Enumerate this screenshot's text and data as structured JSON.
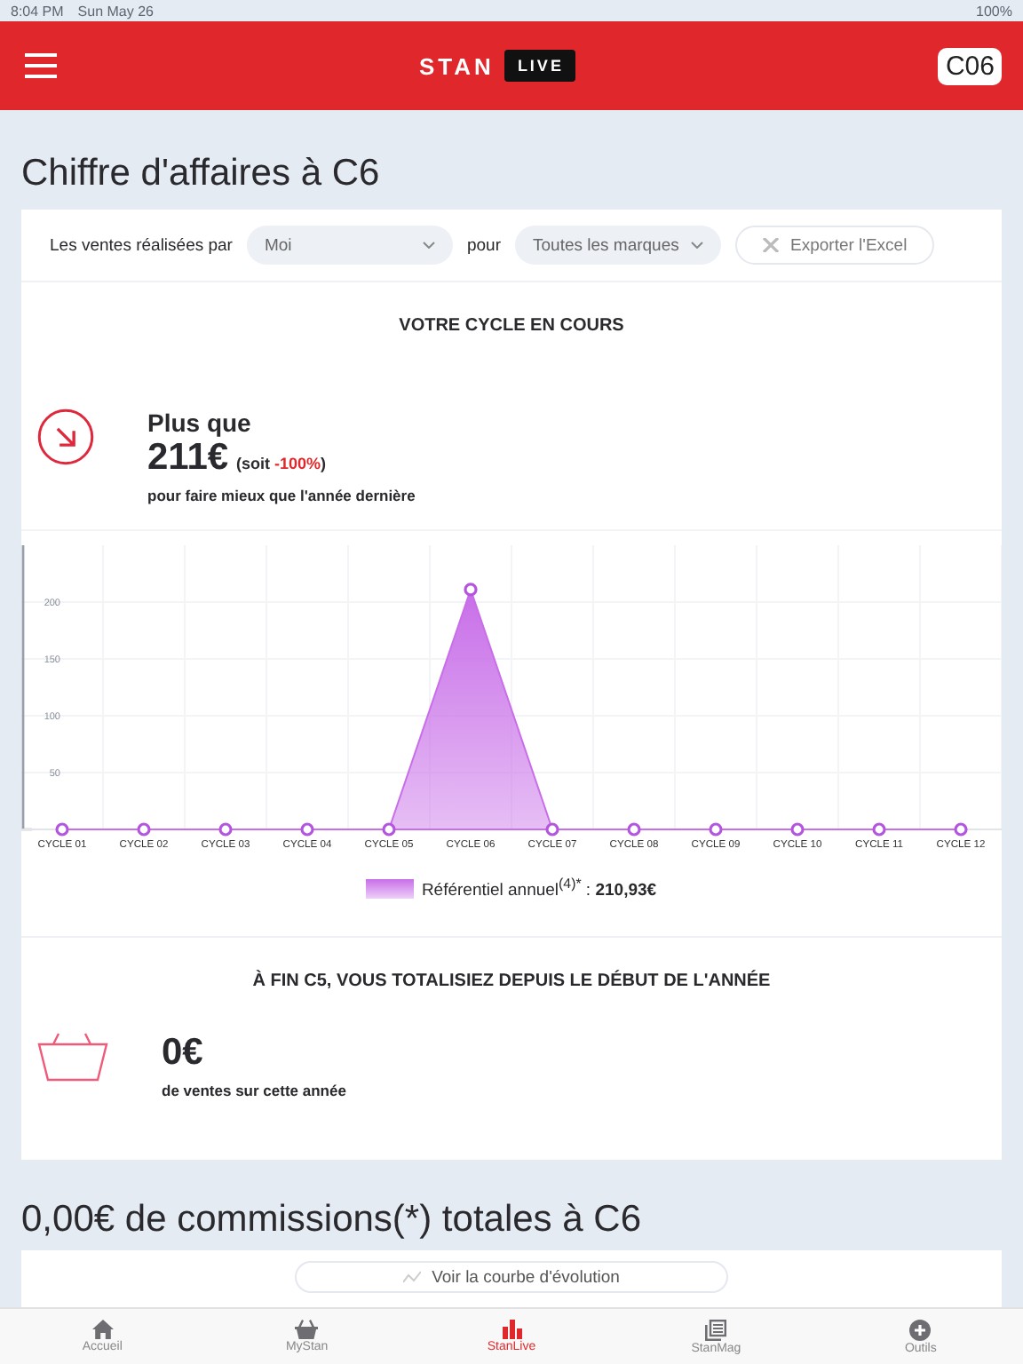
{
  "status_bar": {
    "time": "8:04 PM",
    "date": "Sun May 26",
    "battery": "100%"
  },
  "header": {
    "logo_left": "STAN",
    "logo_right": "LIVE",
    "cycle_badge": "C06"
  },
  "page_title": "Chiffre d'affaires à C6",
  "filters": {
    "label": "Les ventes réalisées par",
    "seller": "Moi",
    "connector": "pour",
    "brand": "Toutes les marques",
    "export_button": "Exporter l'Excel"
  },
  "current_cycle": {
    "heading": "VOTRE CYCLE EN COURS",
    "line1": "Plus que",
    "amount": "211€",
    "soit": "(soit ",
    "percent": "-100%",
    "soit_end": ")",
    "caption": "pour faire mieux que l'année dernière",
    "chart_data": {
      "type": "area",
      "categories": [
        "CYCLE 01",
        "CYCLE 02",
        "CYCLE 03",
        "CYCLE 04",
        "CYCLE 05",
        "CYCLE 06",
        "CYCLE 07",
        "CYCLE 08",
        "CYCLE 09",
        "CYCLE 10",
        "CYCLE 11",
        "CYCLE 12"
      ],
      "ylim": [
        0,
        250
      ],
      "grid": true,
      "yticks": [
        50,
        100,
        150,
        200
      ],
      "series": [
        {
          "name": "Référentiel annuel$^{(4)*}$",
          "color": "#c86ee8",
          "values": [
            0,
            0,
            0,
            0,
            0,
            211,
            0,
            0,
            0,
            0,
            0,
            0
          ]
        }
      ]
    },
    "legend_value": ": **210,93€**"
  },
  "year_total": {
    "heading": "À FIN C5, VOUS TOTALISIEZ DEPUIS LE DÉBUT DE L'ANNÉE",
    "amount": "0€",
    "caption": "de ventes sur cette année"
  },
  "commissions_title": "0,00€ de commissions(*) totales à C6",
  "evolution_button": "Voir la courbe d'évolution",
  "tab_bar": [
    {
      "label": "Accueil",
      "selected": false
    },
    {
      "label": "MyStan",
      "selected": false
    },
    {
      "label": "StanLive",
      "selected": true
    },
    {
      "label": "StanMag",
      "selected": false
    },
    {
      "label": "Outils",
      "selected": false
    }
  ]
}
